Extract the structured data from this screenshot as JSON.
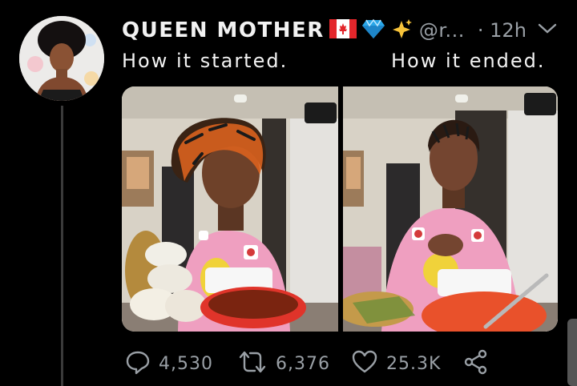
{
  "tweet": {
    "author_name": "QUEEN MOTHER",
    "emojis": [
      "canada-flag",
      "gem",
      "sparkles"
    ],
    "handle": "@r...",
    "separator": "·",
    "time": "12h",
    "text_left": "How it started.",
    "text_right": "How it ended."
  },
  "actions": {
    "replies": "4,530",
    "retweets": "6,376",
    "likes": "25.3K"
  },
  "icons": [
    "reply-icon",
    "retweet-icon",
    "like-icon",
    "share-icon",
    "chevron-down-icon"
  ],
  "colors": {
    "background": "#000000",
    "text": "#f2f2f2",
    "muted": "#9aa0a6",
    "shirt_pink": "#ef9fc0",
    "bowl_red": "#e0342a"
  }
}
